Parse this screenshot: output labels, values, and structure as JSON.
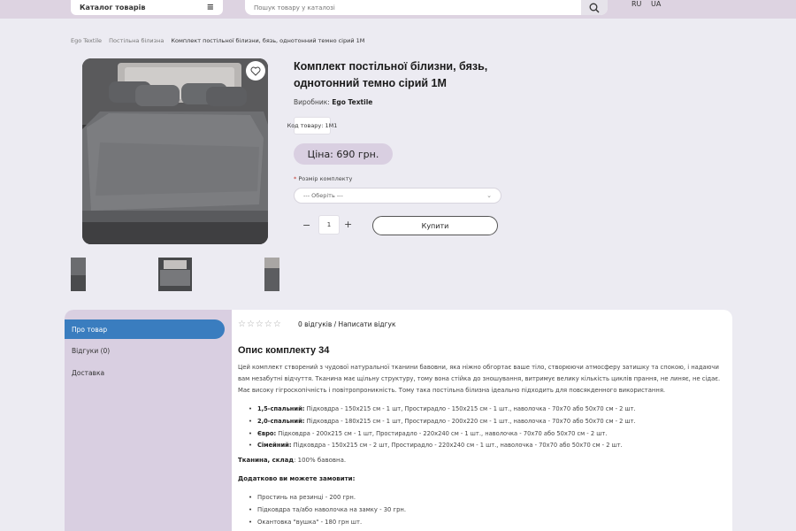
{
  "header": {
    "catalog_label": "Каталог товарів",
    "search_placeholder": "Пошук товару у каталозі",
    "lang_ru": "RU",
    "lang_ua": "UA"
  },
  "breadcrumb": [
    "Ego Textile",
    "Постільна білизна",
    "Комплект постільної білизни, бязь, однотонний темно сірий 1М"
  ],
  "product": {
    "title": "Комплект постільної білизни, бязь, однотонний темно сірий 1М",
    "maker_label": "Виробник:",
    "maker_value": "Ego Textile",
    "code": "Код товару: 1М1",
    "price": "Ціна: 690 грн.",
    "size_label": "Розмір комплекту",
    "size_placeholder": "--- Оберіть ---",
    "quantity": "1",
    "buy_label": "Купити"
  },
  "tabs": [
    {
      "label": "Про товар"
    },
    {
      "label": "Відгуки (0)"
    },
    {
      "label": "Доставка"
    }
  ],
  "reviews": {
    "stars": "☆☆☆☆☆",
    "link": "0 відгуків / Написати відгук"
  },
  "description": {
    "title": "Опис комплекту 34",
    "paragraph": "Цей комплект створений з чудової натуральної тканини бавовни, яка ніжно обгортає ваше тіло, створюючи атмосферу затишку та спокою, і надаючи вам незабутні відчуття. Тканина має щільну структуру, тому вона стійка до зношування, витримує велику кількість циклів прання, не линяє, не сідає. Має високу гігроскопічність і повітропроникність. Тому така постільна білизна ідеально підходить для повсякденного використання.",
    "sets": [
      {
        "name": "1,5-спальний:",
        "text": " Підковдра - 150x215 см - 1 шт, Простирадло - 150x215 см - 1 шт., наволочка - 70x70 або 50x70 см - 2 шт."
      },
      {
        "name": "2,0-спальний:",
        "text": " Підковдра - 180x215 см - 1 шт, Простирадло - 200x220 см - 1 шт., наволочка - 70x70 або 50x70 см - 2 шт."
      },
      {
        "name": "Євро:",
        "text": " Підковдра - 200x215 см - 1 шт, Простирадло - 220x240 см - 1 шт., наволочка - 70x70 або 50x70 см - 2 шт."
      },
      {
        "name": "Сімейний:",
        "text": " Підковдра - 150x215 см - 2 шт, Простирадло - 220x240 см - 1 шт., наволочка - 70x70 або 50x70 см - 2 шт."
      }
    ],
    "fabric_label": "Тканина, склад",
    "fabric_value": ": 100% бавовна.",
    "order_title": "Додатково ви можете замовити:",
    "extras": [
      "Простинь на резинці - 200 грн.",
      "Підковдра та/або наволочка на замку - 30 грн.",
      "Окантовка \"вушка\" - 180 грн шт."
    ]
  }
}
